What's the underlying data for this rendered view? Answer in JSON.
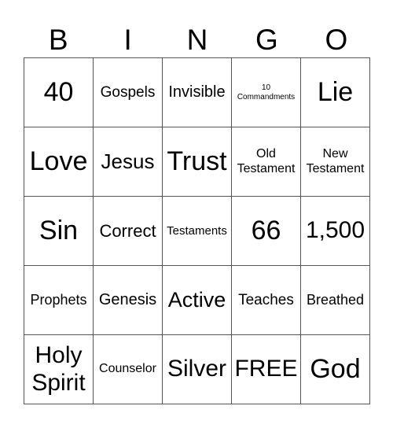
{
  "header": [
    "B",
    "I",
    "N",
    "G",
    "O"
  ],
  "grid": [
    [
      {
        "t": "40",
        "s": 34
      },
      {
        "t": "Gospels",
        "s": 19
      },
      {
        "t": "Invisible",
        "s": 20
      },
      {
        "t": "10 Commandments",
        "s": 10
      },
      {
        "t": "Lie",
        "s": 34
      }
    ],
    [
      {
        "t": "Love",
        "s": 34
      },
      {
        "t": "Jesus",
        "s": 26
      },
      {
        "t": "Trust",
        "s": 34
      },
      {
        "t": "Old Testament",
        "s": 16
      },
      {
        "t": "New Testament",
        "s": 16
      }
    ],
    [
      {
        "t": "Sin",
        "s": 34
      },
      {
        "t": "Correct",
        "s": 22
      },
      {
        "t": "Testaments",
        "s": 15
      },
      {
        "t": "66",
        "s": 34
      },
      {
        "t": "1,500",
        "s": 30
      }
    ],
    [
      {
        "t": "Prophets",
        "s": 18
      },
      {
        "t": "Genesis",
        "s": 20
      },
      {
        "t": "Active",
        "s": 27
      },
      {
        "t": "Teaches",
        "s": 19
      },
      {
        "t": "Breathed",
        "s": 18
      }
    ],
    [
      {
        "t": "Holy Spirit",
        "s": 30
      },
      {
        "t": "Counselor",
        "s": 16
      },
      {
        "t": "Silver",
        "s": 30
      },
      {
        "t": "FREE",
        "s": 30
      },
      {
        "t": "God",
        "s": 34
      }
    ]
  ]
}
